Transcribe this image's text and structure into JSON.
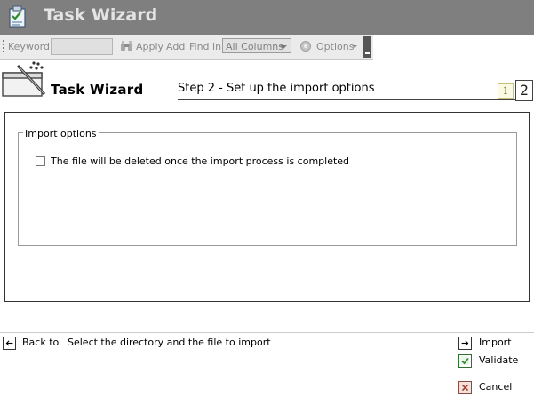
{
  "window": {
    "title": "Task Wizard",
    "icon": "task-wizard-app-icon"
  },
  "toolbar": {
    "keyword_label": "Keyword",
    "keyword_value": "",
    "apply_label": "Apply",
    "add_label": "Add",
    "find_in_label": "Find in",
    "find_in_selected": "All Columns",
    "options_label": "Options"
  },
  "wizard": {
    "title": "Task Wizard",
    "step_title": "Step 2 - Set up the import options",
    "steps": [
      "1",
      "2"
    ],
    "current_step": 2
  },
  "import_options": {
    "legend": "Import options",
    "delete_file_label": "The file will be deleted once the import process is completed",
    "delete_file_checked": false
  },
  "footer": {
    "back_label": "Back to",
    "back_description": "Select the directory and the file to import",
    "import_label": "Import",
    "validate_label": "Validate",
    "cancel_label": "Cancel"
  },
  "colors": {
    "titlebar": "#7f7f7f",
    "toolbar": "#ebebeb",
    "validate": "#2f8f2f",
    "cancel": "#a04030"
  }
}
